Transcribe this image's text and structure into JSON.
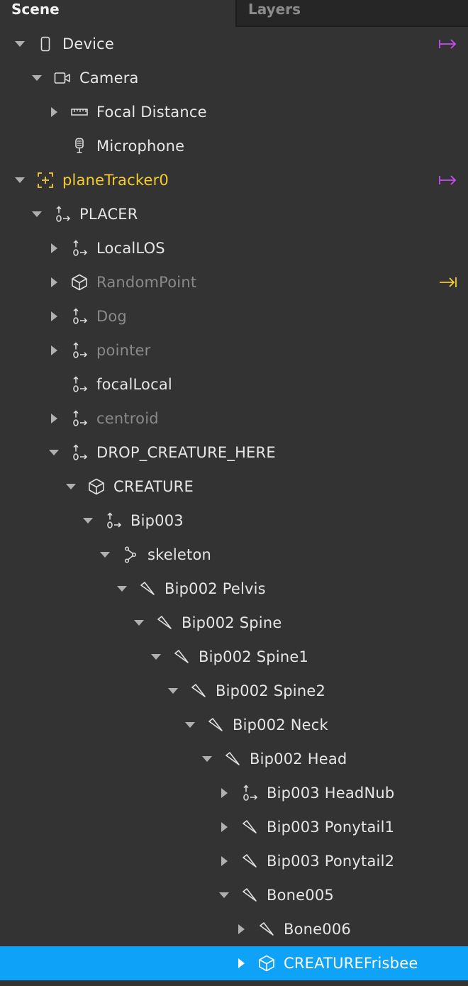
{
  "tabs": {
    "scene": "Scene",
    "layers": "Layers"
  },
  "colors": {
    "accent_purple": "#c94df0",
    "accent_yellow": "#f5cc2e",
    "selection_blue": "#0ea2f8",
    "background": "#333333"
  },
  "tree": [
    {
      "label": "Device",
      "depth": 0,
      "caret": "open",
      "icon": "device-icon",
      "tone": "normal",
      "action": "link-purple-icon"
    },
    {
      "label": "Camera",
      "depth": 1,
      "caret": "open",
      "icon": "camera-icon",
      "tone": "normal"
    },
    {
      "label": "Focal Distance",
      "depth": 2,
      "caret": "closed",
      "icon": "ruler-icon",
      "tone": "normal"
    },
    {
      "label": "Microphone",
      "depth": 2,
      "caret": "none",
      "icon": "microphone-icon",
      "tone": "normal"
    },
    {
      "label": "planeTracker0",
      "depth": 0,
      "caret": "open",
      "icon": "plane-tracker-icon",
      "tone": "yellow",
      "action": "link-purple-icon"
    },
    {
      "label": "PLACER",
      "depth": 1,
      "caret": "open",
      "icon": "null-object-icon",
      "tone": "normal"
    },
    {
      "label": "LocalLOS",
      "depth": 2,
      "caret": "closed",
      "icon": "null-object-icon",
      "tone": "normal"
    },
    {
      "label": "RandomPoint",
      "depth": 2,
      "caret": "closed",
      "icon": "3d-object-icon",
      "tone": "dim",
      "action": "link-yellow-icon"
    },
    {
      "label": "Dog",
      "depth": 2,
      "caret": "closed",
      "icon": "null-object-icon",
      "tone": "dim"
    },
    {
      "label": "pointer",
      "depth": 2,
      "caret": "closed",
      "icon": "null-object-icon",
      "tone": "dim"
    },
    {
      "label": "focalLocal",
      "depth": 2,
      "caret": "none",
      "icon": "null-object-icon",
      "tone": "normal"
    },
    {
      "label": "centroid",
      "depth": 2,
      "caret": "closed",
      "icon": "null-object-icon",
      "tone": "dim"
    },
    {
      "label": "DROP_CREATURE_HERE",
      "depth": 2,
      "caret": "open",
      "icon": "null-object-icon",
      "tone": "normal"
    },
    {
      "label": "CREATURE",
      "depth": 3,
      "caret": "open",
      "icon": "3d-object-icon",
      "tone": "normal"
    },
    {
      "label": "Bip003",
      "depth": 4,
      "caret": "open",
      "icon": "null-object-icon",
      "tone": "normal"
    },
    {
      "label": "skeleton",
      "depth": 5,
      "caret": "open",
      "icon": "skeleton-icon",
      "tone": "normal"
    },
    {
      "label": "Bip002 Pelvis",
      "depth": 6,
      "caret": "open",
      "icon": "bone-icon",
      "tone": "normal"
    },
    {
      "label": "Bip002 Spine",
      "depth": 7,
      "caret": "open",
      "icon": "bone-icon",
      "tone": "normal"
    },
    {
      "label": "Bip002 Spine1",
      "depth": 8,
      "caret": "open",
      "icon": "bone-icon",
      "tone": "normal"
    },
    {
      "label": "Bip002 Spine2",
      "depth": 9,
      "caret": "open",
      "icon": "bone-icon",
      "tone": "normal"
    },
    {
      "label": "Bip002 Neck",
      "depth": 10,
      "caret": "open",
      "icon": "bone-icon",
      "tone": "normal"
    },
    {
      "label": "Bip002 Head",
      "depth": 11,
      "caret": "open",
      "icon": "bone-icon",
      "tone": "normal"
    },
    {
      "label": "Bip003 HeadNub",
      "depth": 12,
      "caret": "closed",
      "icon": "null-object-icon",
      "tone": "normal"
    },
    {
      "label": "Bip003 Ponytail1",
      "depth": 12,
      "caret": "closed",
      "icon": "bone-icon",
      "tone": "normal"
    },
    {
      "label": "Bip003 Ponytail2",
      "depth": 12,
      "caret": "closed",
      "icon": "bone-icon",
      "tone": "normal"
    },
    {
      "label": "Bone005",
      "depth": 12,
      "caret": "open",
      "icon": "bone-icon",
      "tone": "normal"
    },
    {
      "label": "Bone006",
      "depth": 13,
      "caret": "closed",
      "icon": "bone-icon",
      "tone": "normal"
    },
    {
      "label": "CREATUREFrisbee",
      "depth": 13,
      "caret": "closed",
      "icon": "3d-object-icon",
      "tone": "normal",
      "selected": true
    }
  ]
}
